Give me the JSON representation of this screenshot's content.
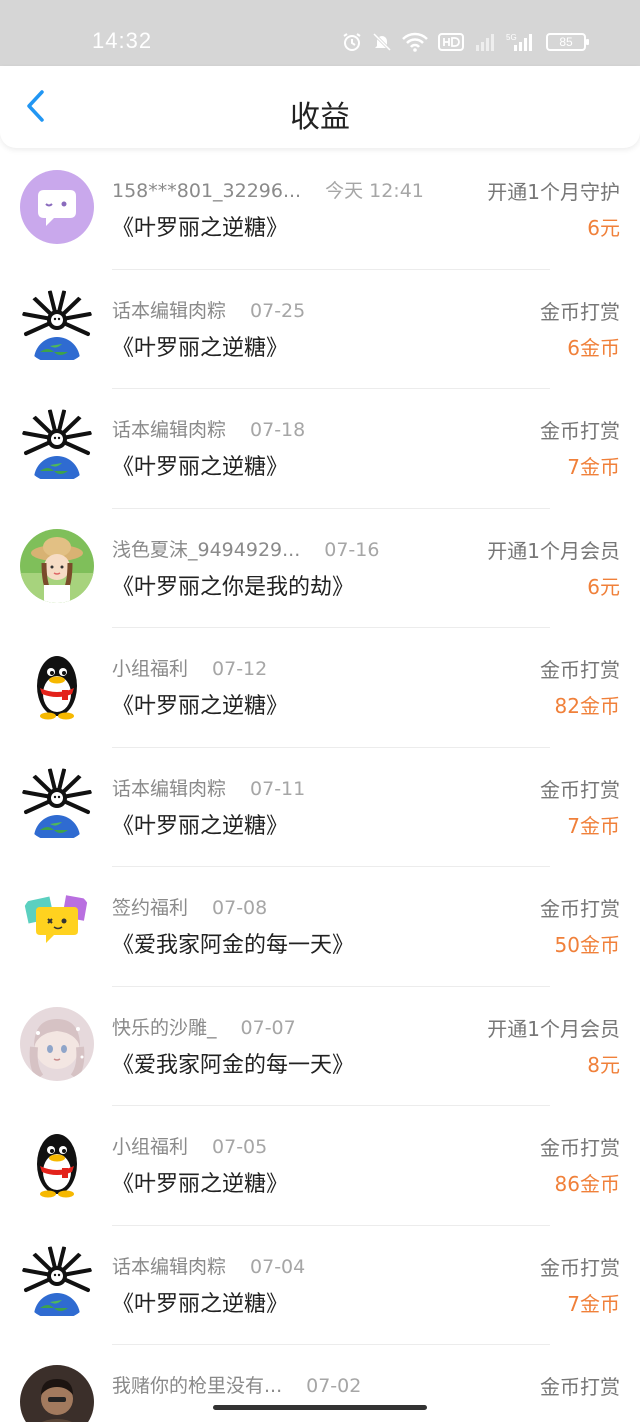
{
  "status_bar": {
    "time": "14:32",
    "battery": "85"
  },
  "header": {
    "title": "收益"
  },
  "colors": {
    "accent": "#2196f3",
    "amount": "#f0803a"
  },
  "rows": [
    {
      "user": "158***801_32296...",
      "date": "今天 12:41",
      "book": "《叶罗丽之逆糖》",
      "type": "开通1个月守护",
      "amount": "6元",
      "avatar": "purple-chat-avatar"
    },
    {
      "user": "话本编辑肉粽",
      "date": "07-25",
      "book": "《叶罗丽之逆糖》",
      "type": "金币打赏",
      "amount": "6金币",
      "avatar": "spider-earth-avatar"
    },
    {
      "user": "话本编辑肉粽",
      "date": "07-18",
      "book": "《叶罗丽之逆糖》",
      "type": "金币打赏",
      "amount": "7金币",
      "avatar": "spider-earth-avatar"
    },
    {
      "user": "浅色夏沫_9494929...",
      "date": "07-16",
      "book": "《叶罗丽之你是我的劫》",
      "type": "开通1个月会员",
      "amount": "6元",
      "avatar": "girl-straw-hat-avatar"
    },
    {
      "user": "小组福利",
      "date": "07-12",
      "book": "《叶罗丽之逆糖》",
      "type": "金币打赏",
      "amount": "82金币",
      "avatar": "penguin-avatar"
    },
    {
      "user": "话本编辑肉粽",
      "date": "07-11",
      "book": "《叶罗丽之逆糖》",
      "type": "金币打赏",
      "amount": "7金币",
      "avatar": "spider-earth-avatar"
    },
    {
      "user": "签约福利",
      "date": "07-08",
      "book": "《爱我家阿金的每一天》",
      "type": "金币打赏",
      "amount": "50金币",
      "avatar": "yellow-chat-avatar"
    },
    {
      "user": "快乐的沙雕_",
      "date": "07-07",
      "book": "《爱我家阿金的每一天》",
      "type": "开通1个月会员",
      "amount": "8元",
      "avatar": "anime-girl-avatar"
    },
    {
      "user": "小组福利",
      "date": "07-05",
      "book": "《叶罗丽之逆糖》",
      "type": "金币打赏",
      "amount": "86金币",
      "avatar": "penguin-avatar"
    },
    {
      "user": "话本编辑肉粽",
      "date": "07-04",
      "book": "《叶罗丽之逆糖》",
      "type": "金币打赏",
      "amount": "7金币",
      "avatar": "spider-earth-avatar"
    },
    {
      "user": "我赌你的枪里没有...",
      "date": "07-02",
      "book": "",
      "type": "金币打赏",
      "amount": "",
      "avatar": "dark-photo-avatar"
    }
  ]
}
